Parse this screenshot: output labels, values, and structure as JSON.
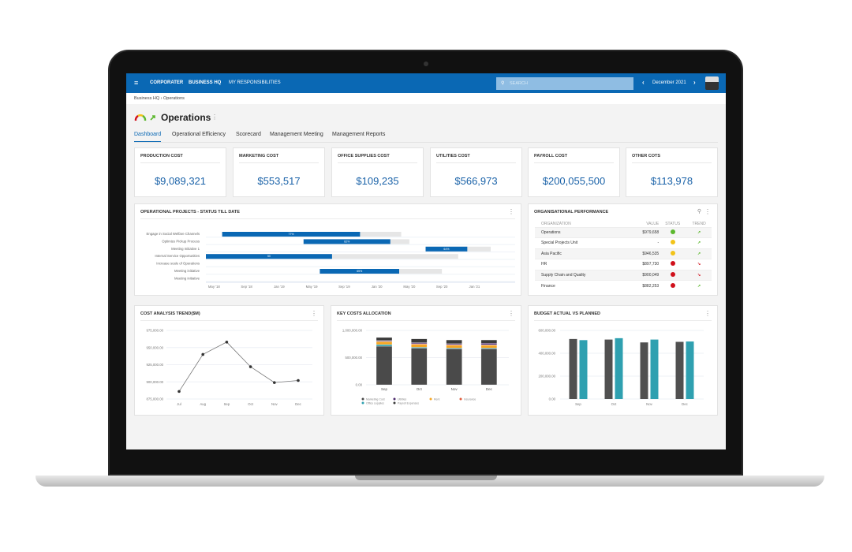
{
  "header": {
    "logo": "CORPORATER",
    "nav": [
      "BUSINESS HQ",
      "MY RESPONSIBILITIES"
    ],
    "search_placeholder": "SEARCH",
    "period": "December 2021"
  },
  "breadcrumb": [
    "Business HQ",
    "Operations"
  ],
  "page": {
    "title": "Operations"
  },
  "tabs": [
    "Dashboard",
    "Operational Efficiency",
    "Scorecard",
    "Management Meeting",
    "Management Reports"
  ],
  "kpis": [
    {
      "label": "PRODUCTION COST",
      "value": "$9,089,321"
    },
    {
      "label": "MARKETING COST",
      "value": "$553,517"
    },
    {
      "label": "OFFICE SUPPLIES COST",
      "value": "$109,235"
    },
    {
      "label": "UTILITIES COST",
      "value": "$566,973"
    },
    {
      "label": "PAYROLL COST",
      "value": "$200,055,500"
    },
    {
      "label": "OTHER COTS",
      "value": "$113,978"
    }
  ],
  "org": {
    "title": "ORGANISATIONAL PERFORMANCE",
    "columns": [
      "ORGANIZATION",
      "VALUE",
      "STATUS",
      "TREND"
    ],
    "rows": [
      {
        "name": "Operations",
        "value": "$979,658",
        "status": "#5cb82e",
        "trend": "up"
      },
      {
        "name": "Special Projects Unit",
        "value": "-",
        "status": "#f2c319",
        "trend": "up"
      },
      {
        "name": "Asia Pacific",
        "value": "$946,535",
        "status": "#f2c319",
        "trend": "up"
      },
      {
        "name": "HR",
        "value": "$897,730",
        "status": "#d0101b",
        "trend": "down"
      },
      {
        "name": "Supply Chain and Quality",
        "value": "$900,049",
        "status": "#d0101b",
        "trend": "down"
      },
      {
        "name": "Finance",
        "value": "$882,253",
        "status": "#d0101b",
        "trend": "up"
      }
    ]
  },
  "chart_data": [
    {
      "type": "gantt",
      "title": "OPERATIONAL PROJECTS - STATUS TILL DATE",
      "xlim": [
        "2018-04",
        "2021-06"
      ],
      "ticks": [
        "May '18",
        "Sep '18",
        "Jan '19",
        "May '19",
        "Sep '19",
        "Jan '20",
        "May '20",
        "Sep '20",
        "Jan '21"
      ],
      "tasks": [
        {
          "name": "Engage in Social Welfare Channels",
          "start": "2018-06",
          "end": "2020-04",
          "progress": 77,
          "label": "77%"
        },
        {
          "name": "Optimize Pickup Process",
          "start": "2019-04",
          "end": "2020-05",
          "progress": 82,
          "label": "82%"
        },
        {
          "name": "Meeting Initiative 1",
          "start": "2020-07",
          "end": "2021-03",
          "progress": 64,
          "label": "64%"
        },
        {
          "name": "Internal Service Opportunities",
          "start": "2018-04",
          "end": "2020-11",
          "progress": 50,
          "label": "50"
        },
        {
          "name": "Increase scale of Operations"
        },
        {
          "name": "Meeting initiative",
          "start": "2019-06",
          "end": "2020-09",
          "progress": 65,
          "label": "65%"
        },
        {
          "name": "Meeting initiative"
        }
      ]
    },
    {
      "type": "line",
      "title": "COST ANALYSIS TREND($M)",
      "categories": [
        "Jul",
        "Aug",
        "Sep",
        "Oct",
        "Nov",
        "Dec"
      ],
      "values": [
        886000,
        940000,
        958000,
        922000,
        899000,
        902000
      ],
      "ylim": [
        875000,
        975000
      ],
      "yticks": [
        "875,000.00",
        "900,000.00",
        "925,000.00",
        "950,000.00",
        "975,000.00"
      ]
    },
    {
      "type": "bar",
      "stacked": true,
      "title": "KEY COSTS ALLOCATION",
      "categories": [
        "Sep",
        "Oct",
        "Nov",
        "Dec"
      ],
      "ylim": [
        0,
        1000000
      ],
      "yticks": [
        "0.00",
        "500,000.00",
        "1,000,000.00"
      ],
      "legend": "bottom",
      "series": [
        {
          "name": "Marketing Cost",
          "color": "#4a4a4a",
          "values": [
            710000,
            675000,
            665000,
            665000
          ]
        },
        {
          "name": "Office supplies",
          "color": "#2fa0b0",
          "values": [
            30000,
            15000,
            12000,
            12000
          ]
        },
        {
          "name": "Rent",
          "color": "#f5a623",
          "values": [
            55000,
            55000,
            50000,
            50000
          ]
        },
        {
          "name": "Insurance",
          "color": "#e05a3a",
          "values": [
            8000,
            10000,
            12000,
            10000
          ]
        },
        {
          "name": "Utilities",
          "color": "#4b2a6b",
          "values": [
            12000,
            20000,
            16000,
            28000
          ]
        },
        {
          "name": "Payroll Expenses",
          "color": "#3a3a3a",
          "values": [
            55000,
            70000,
            70000,
            60000
          ]
        }
      ]
    },
    {
      "type": "bar",
      "title": "BUDGET ACTUAL VS PLANNED",
      "categories": [
        "Sep",
        "Oct",
        "Nov",
        "Dec"
      ],
      "ylim": [
        0,
        600000
      ],
      "yticks": [
        "0.00",
        "200,000.00",
        "400,000.00",
        "600,000.00"
      ],
      "series": [
        {
          "color": "#505050",
          "values": [
            525000,
            520000,
            495000,
            500000
          ]
        },
        {
          "color": "#2fa0b0",
          "values": [
            515000,
            532000,
            520000,
            503000
          ]
        }
      ]
    }
  ]
}
